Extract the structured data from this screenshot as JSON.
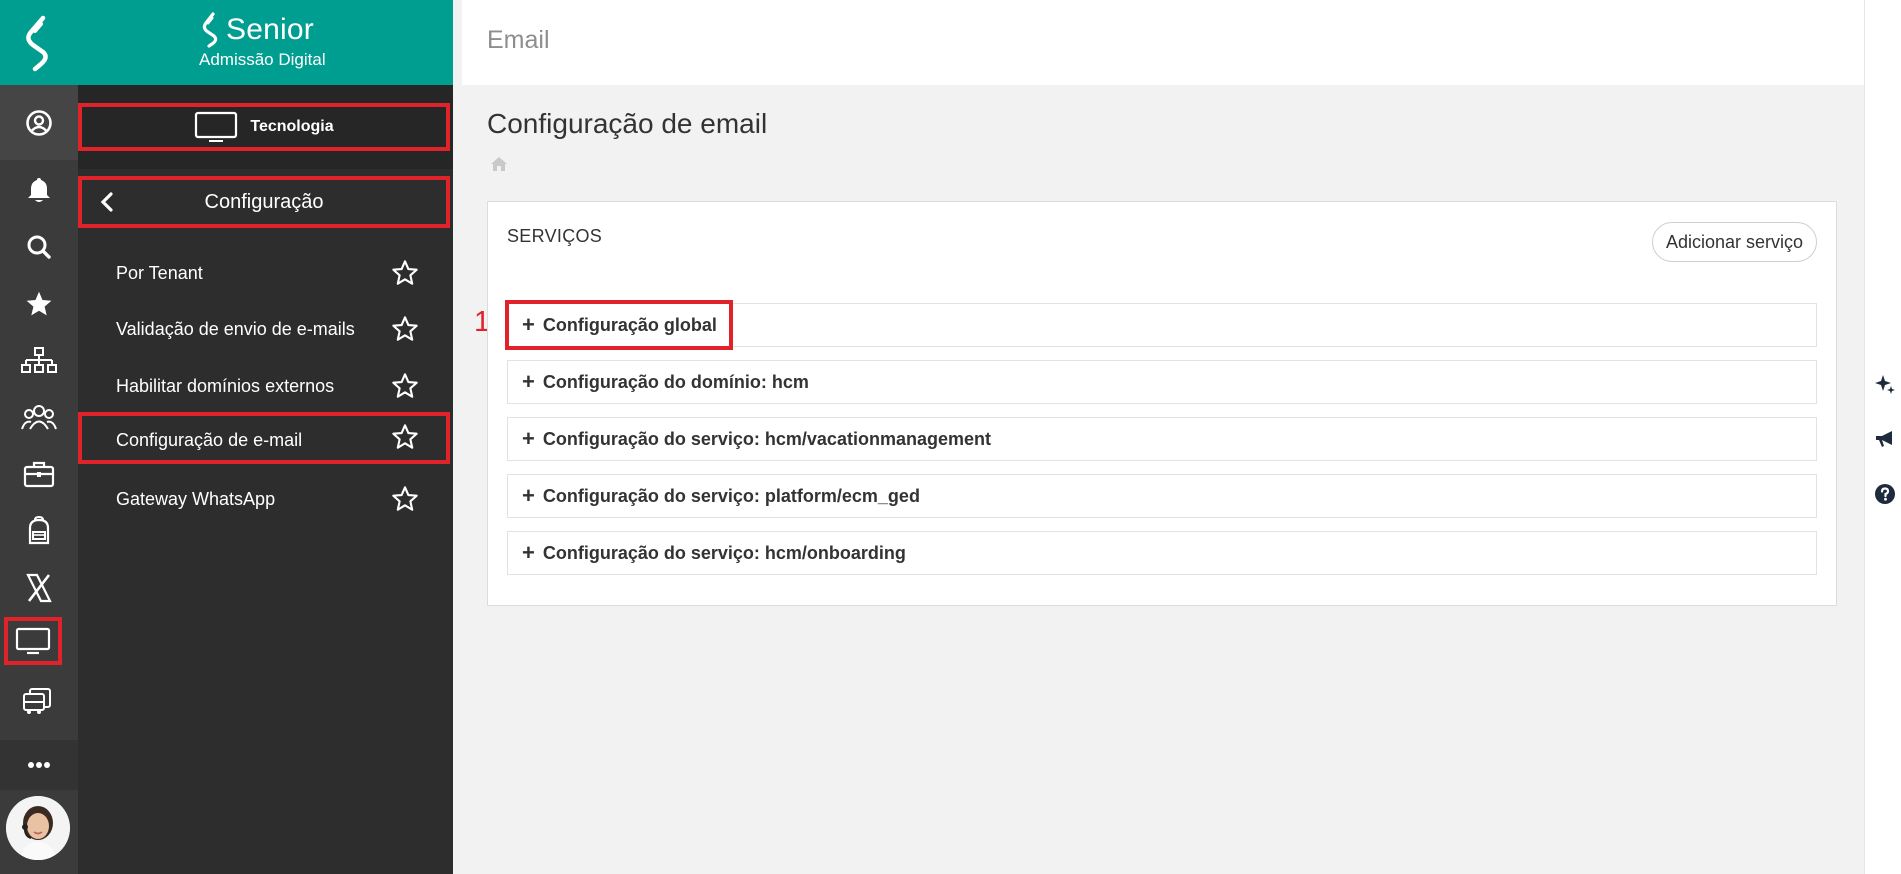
{
  "brand": {
    "name": "Senior",
    "subtitle": "Admissão Digital"
  },
  "rail": {
    "icons": [
      "logo-icon",
      "user-circle-icon",
      "bell-icon",
      "search-icon",
      "star-icon",
      "org-chart-icon",
      "people-icon",
      "briefcase-icon",
      "backpack-icon",
      "x-brand-icon",
      "monitor-icon",
      "bus-icon",
      "more-icon"
    ]
  },
  "sidebar": {
    "section_label": "Tecnologia",
    "submenu_label": "Configuração",
    "items": [
      {
        "label": "Por Tenant"
      },
      {
        "label": "Validação de envio de e-mails"
      },
      {
        "label": "Habilitar domínios externos"
      },
      {
        "label": "Configuração de e-mail"
      },
      {
        "label": "Gateway WhatsApp"
      }
    ]
  },
  "header": {
    "title": "Email"
  },
  "page": {
    "title": "Configuração de email"
  },
  "services": {
    "title": "SERVIÇOS",
    "add_button": "Adicionar serviço",
    "step_marker": "1",
    "rows": [
      {
        "label": "Configuração global"
      },
      {
        "label": "Configuração do domínio: hcm"
      },
      {
        "label": "Configuração do serviço: hcm/vacationmanagement"
      },
      {
        "label": "Configuração do serviço: platform/ecm_ged"
      },
      {
        "label": "Configuração do serviço: hcm/onboarding"
      }
    ]
  },
  "colors": {
    "brand": "#009d91",
    "highlight": "#e0222a",
    "rail": "#3b3b3b",
    "panel": "#2d2d2d"
  },
  "right_strip": {
    "icons": [
      "sparkle-icon",
      "megaphone-icon",
      "help-icon"
    ]
  }
}
